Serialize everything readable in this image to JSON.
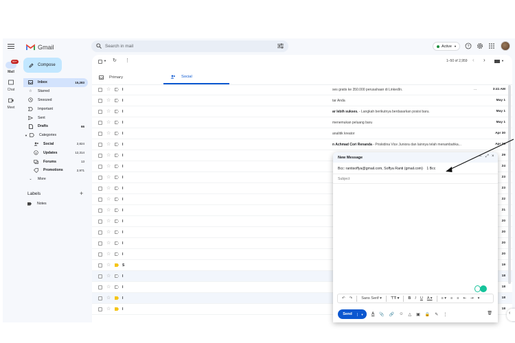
{
  "rail": {
    "mail_label": "Mail",
    "mail_badge": "99+",
    "chat_label": "Chat",
    "meet_label": "Meet"
  },
  "header": {
    "app_name": "Gmail",
    "search_placeholder": "Search in mail",
    "status_label": "Active"
  },
  "sidebar": {
    "compose_label": "Compose",
    "items": [
      {
        "label": "Inbox",
        "count": "15,283",
        "icon": "inbox-icon"
      },
      {
        "label": "Starred",
        "count": "",
        "icon": "star-icon"
      },
      {
        "label": "Snoozed",
        "count": "",
        "icon": "clock-icon"
      },
      {
        "label": "Important",
        "count": "",
        "icon": "important-icon"
      },
      {
        "label": "Sent",
        "count": "",
        "icon": "send-icon"
      },
      {
        "label": "Drafts",
        "count": "66",
        "icon": "draft-icon"
      },
      {
        "label": "Categories",
        "count": "",
        "icon": "label-icon"
      },
      {
        "label": "Social",
        "count": "2,824",
        "icon": "people-icon"
      },
      {
        "label": "Updates",
        "count": "12,314",
        "icon": "info-icon"
      },
      {
        "label": "Forums",
        "count": "13",
        "icon": "forum-icon"
      },
      {
        "label": "Promotions",
        "count": "2,971",
        "icon": "tag-icon"
      },
      {
        "label": "More",
        "count": "",
        "icon": "chevron-down-icon"
      }
    ],
    "labels_title": "Labels",
    "labels": [
      {
        "label": "Notes"
      }
    ]
  },
  "toolbar": {
    "pager": "1–50 of 2,959"
  },
  "tabs": [
    {
      "label": "Primary",
      "icon": "inbox-icon"
    },
    {
      "label": "Social",
      "icon": "people-icon"
    }
  ],
  "rows": [
    {
      "sender": "I",
      "snippet_bold": "",
      "snippet": "ses gratis ke 350.000 perusahaan di LinkedIn.",
      "dots": "...",
      "date": "3:41 AM",
      "important": false,
      "read": false
    },
    {
      "sender": "I",
      "snippet_bold": "",
      "snippet": "tar Anda",
      "dots": "",
      "date": "May 1",
      "important": false,
      "read": false
    },
    {
      "sender": "I",
      "snippet_bold": "ar lebih sukses.",
      "snippet": " - Langkah berikutnya berdasarkan posisi baru.",
      "dots": "",
      "date": "May 1",
      "important": false,
      "read": false
    },
    {
      "sender": "I",
      "snippet_bold": "",
      "snippet": "menemukan peluang baru",
      "dots": "",
      "date": "May 1",
      "important": false,
      "read": false
    },
    {
      "sender": "I",
      "snippet_bold": "",
      "snippet": "analitik kreator",
      "dots": "",
      "date": "Apr 30",
      "important": false,
      "read": false
    },
    {
      "sender": "I",
      "snippet_bold": "n Achmad Cori Renanda",
      "snippet": " - Priskidina Vice Juniora dan lainnya telah menambahka...",
      "dots": "",
      "date": "Apr 30",
      "important": false,
      "read": false
    },
    {
      "sender": "I",
      "snippet_bold": "",
      "snippet": "",
      "dots": "",
      "date": "29",
      "important": false,
      "read": false
    },
    {
      "sender": "I",
      "snippet_bold": "",
      "snippet": "",
      "dots": "",
      "date": "24",
      "important": false,
      "read": false
    },
    {
      "sender": "I",
      "snippet_bold": "",
      "snippet": "",
      "dots": "",
      "date": "23",
      "important": false,
      "read": false
    },
    {
      "sender": "I",
      "snippet_bold": "",
      "snippet": "",
      "dots": "",
      "date": "23",
      "important": false,
      "read": false
    },
    {
      "sender": "I",
      "snippet_bold": "",
      "snippet": "",
      "dots": "",
      "date": "22",
      "important": false,
      "read": false
    },
    {
      "sender": "I",
      "snippet_bold": "",
      "snippet": "",
      "dots": "",
      "date": "21",
      "important": false,
      "read": false
    },
    {
      "sender": "I",
      "snippet_bold": "",
      "snippet": "",
      "dots": "",
      "date": "20",
      "important": false,
      "read": false
    },
    {
      "sender": "I",
      "snippet_bold": "",
      "snippet": "",
      "dots": "",
      "date": "20",
      "important": false,
      "read": false
    },
    {
      "sender": "I",
      "snippet_bold": "",
      "snippet": "",
      "dots": "",
      "date": "20",
      "important": false,
      "read": false
    },
    {
      "sender": "I",
      "snippet_bold": "",
      "snippet": "",
      "dots": "",
      "date": "20",
      "important": false,
      "read": false
    },
    {
      "sender": "S",
      "snippet_bold": "",
      "snippet": "",
      "dots": "",
      "date": "19",
      "important": true,
      "read": false
    },
    {
      "sender": "I",
      "snippet_bold": "",
      "snippet": "",
      "dots": "",
      "date": "18",
      "important": false,
      "read": true
    },
    {
      "sender": "I",
      "snippet_bold": "",
      "snippet": "",
      "dots": "",
      "date": "18",
      "important": false,
      "read": false
    },
    {
      "sender": "I",
      "snippet_bold": "",
      "snippet": "",
      "dots": "",
      "date": "18",
      "important": true,
      "read": true
    },
    {
      "sender": "I",
      "snippet_bold": "",
      "snippet": "",
      "dots": "",
      "date": "18",
      "important": true,
      "read": false
    }
  ],
  "compose_window": {
    "title": "New Message",
    "bcc_line": "Bcc: rantisoffya@gmail.com, Soffya Ranti (gmail.com)",
    "bcc_toggle": "1 Bcc",
    "subject_placeholder": "Subject",
    "font_name": "Sans Serif",
    "send_label": "Send"
  },
  "colors": {
    "accent": "#0b57d0",
    "compose_bg": "#c2e7ff",
    "selected_nav": "#d3e3fd",
    "active_status": "#1e8e3e",
    "important": "#f5c518",
    "badge": "#c5221f"
  }
}
